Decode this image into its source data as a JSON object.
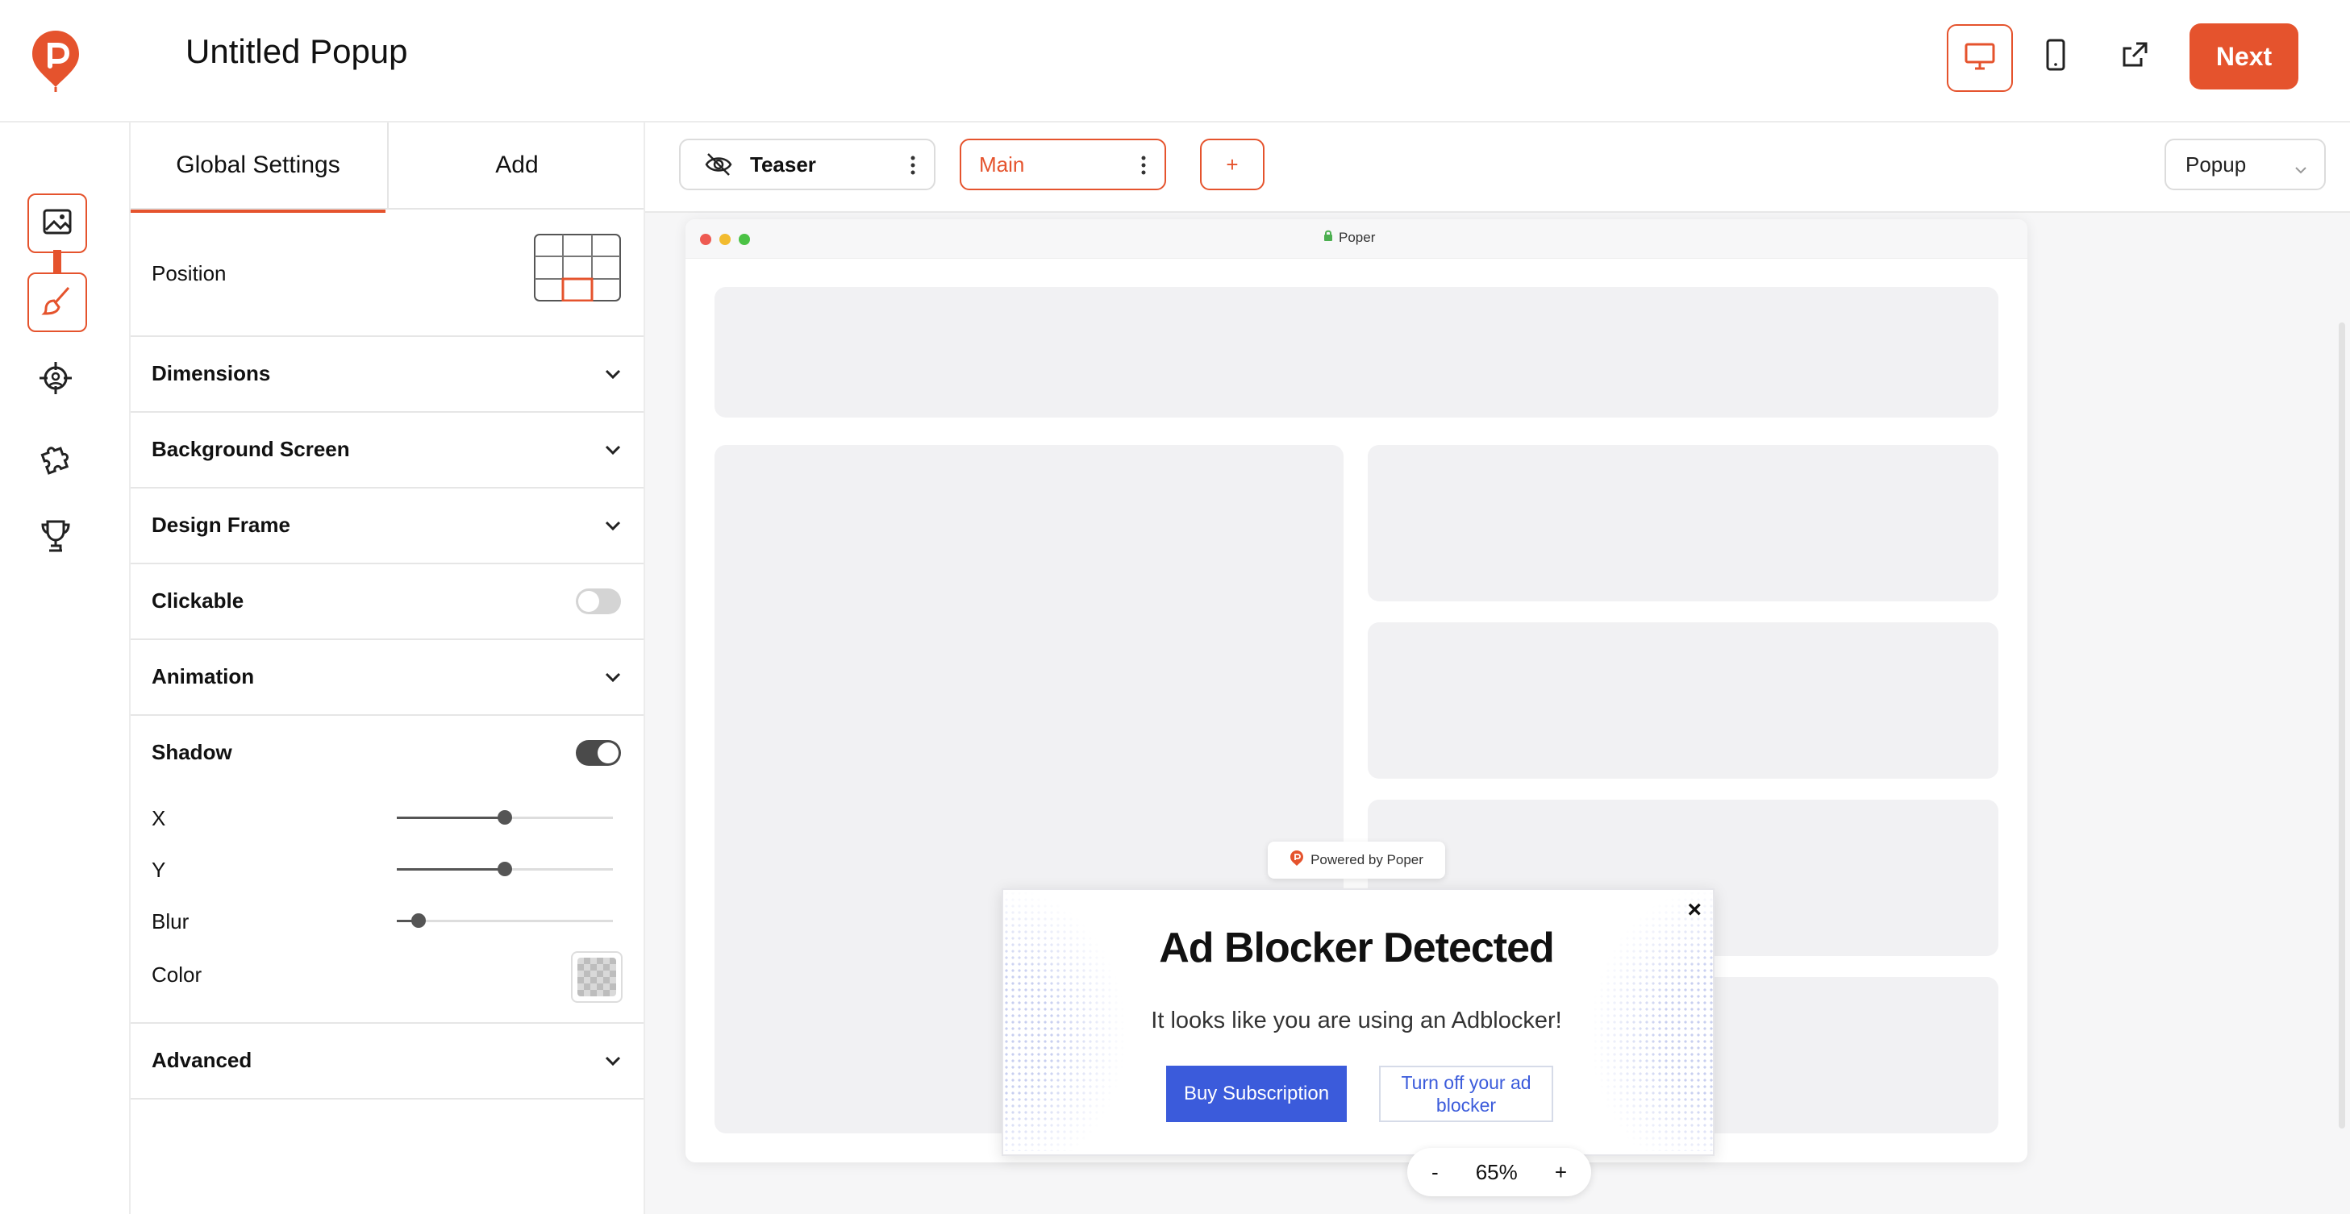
{
  "app": {
    "title": "Untitled Popup",
    "next_label": "Next",
    "accent": "#e5532d"
  },
  "toolbar": {
    "icons": [
      "desktop-icon",
      "mobile-icon",
      "external-link-icon"
    ],
    "active_device": "desktop"
  },
  "rail": {
    "icons": [
      "image-icon",
      "brush-icon",
      "target-icon",
      "puzzle-icon",
      "trophy-icon"
    ],
    "active": [
      "image-icon",
      "brush-icon"
    ]
  },
  "panel": {
    "tabs": [
      {
        "label": "Global Settings",
        "active": true
      },
      {
        "label": "Add",
        "active": false
      }
    ],
    "position_label": "Position",
    "sections": {
      "dimensions": "Dimensions",
      "background_screen": "Background Screen",
      "design_frame": "Design Frame",
      "clickable": "Clickable",
      "animation": "Animation",
      "shadow": "Shadow",
      "advanced": "Advanced"
    },
    "clickable_on": false,
    "shadow_on": true,
    "shadow": {
      "x_label": "X",
      "x_value": 0.5,
      "y_label": "Y",
      "y_value": 0.5,
      "blur_label": "Blur",
      "blur_value": 0.1,
      "color_label": "Color"
    }
  },
  "steps": {
    "teaser": "Teaser",
    "main": "Main",
    "add": "+",
    "type_select": "Popup"
  },
  "browser": {
    "site": "Poper"
  },
  "popup": {
    "powered_by": "Powered by Poper",
    "close": "×",
    "heading": "Ad Blocker Detected",
    "subtext": "It looks like you are using an Adblocker!",
    "primary_button": "Buy Subscription",
    "secondary_button": "Turn off your ad blocker",
    "primary_color": "#3b5bdb"
  },
  "zoom": {
    "minus": "-",
    "level": "65%",
    "plus": "+"
  }
}
